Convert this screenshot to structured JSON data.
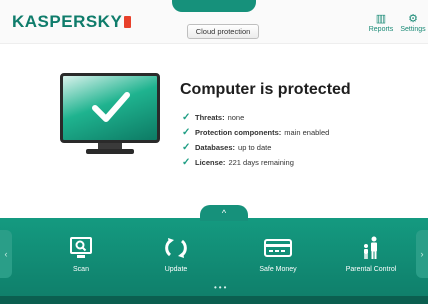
{
  "header": {
    "logo_text": "KASPERSKY",
    "cloud_button": "Cloud protection",
    "reports_label": "Reports",
    "settings_label": "Settings"
  },
  "status": {
    "title": "Computer is protected",
    "items": [
      {
        "label": "Threats:",
        "value": "none"
      },
      {
        "label": "Protection components:",
        "value": "main enabled"
      },
      {
        "label": "Databases:",
        "value": "up to date"
      },
      {
        "label": "License:",
        "value": "221 days remaining"
      }
    ]
  },
  "tools": [
    {
      "label": "Scan",
      "icon": "scan-icon"
    },
    {
      "label": "Update",
      "icon": "update-icon"
    },
    {
      "label": "Safe Money",
      "icon": "card-icon"
    },
    {
      "label": "Parental Control",
      "icon": "family-icon"
    }
  ],
  "colors": {
    "accent": "#16917b",
    "panel": "#149a80",
    "logo_red": "#e8402b"
  }
}
